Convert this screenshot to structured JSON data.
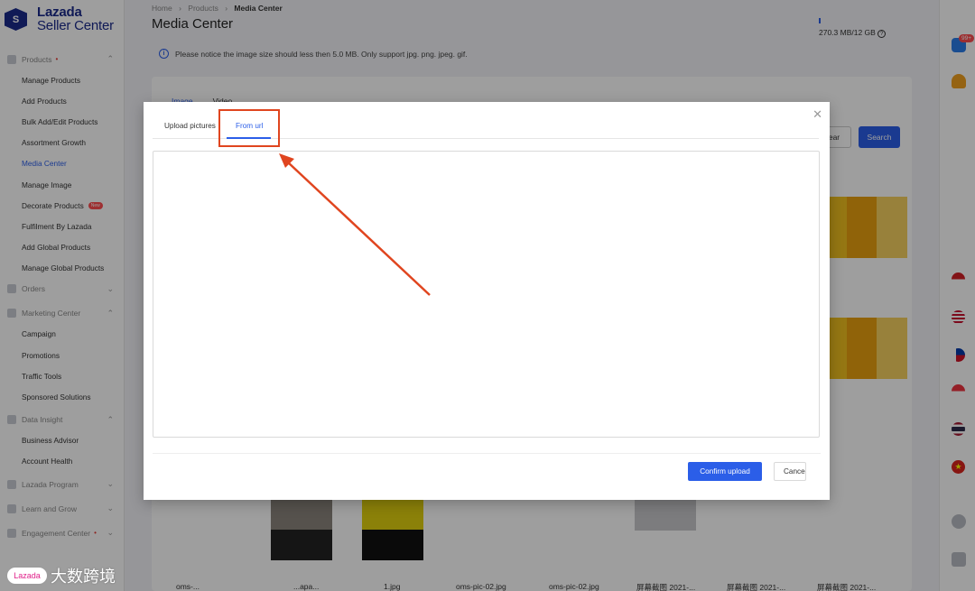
{
  "brand": {
    "line1": "Lazada",
    "line2": "Seller Center",
    "mark": "S"
  },
  "sidebar": {
    "groups": [
      {
        "label": "Products",
        "dot": "•",
        "items": [
          "Manage Products",
          "Add Products",
          "Bulk Add/Edit Products",
          "Assortment Growth",
          "Media Center",
          "Manage Image",
          "Decorate Products",
          "Fulfilment By Lazada",
          "Add Global Products",
          "Manage Global Products"
        ]
      },
      {
        "label": "Orders"
      },
      {
        "label": "Marketing Center",
        "items": [
          "Campaign",
          "Promotions",
          "Traffic Tools",
          "Sponsored Solutions"
        ]
      },
      {
        "label": "Data Insight",
        "items": [
          "Business Advisor",
          "Account Health"
        ]
      },
      {
        "label": "Lazada Program"
      },
      {
        "label": "Learn and Grow"
      },
      {
        "label": "Engagement Center",
        "dot": "•"
      }
    ],
    "new_badge": "New"
  },
  "watermark": {
    "logo": "Lazada",
    "text": "大数跨境"
  },
  "breadcrumb": {
    "home": "Home",
    "products": "Products",
    "current": "Media Center",
    "sep": "›"
  },
  "page_title": "Media Center",
  "storage": "270.3 MB/12 GB",
  "notice": "Please notice the image size should less then 5.0 MB. Only support jpg. png. jpeg. gif.",
  "tabs_behind": {
    "image": "Image",
    "video": "Video"
  },
  "search_btn": "Search",
  "clear_btn": "ear",
  "files": [
    "oms-...",
    "...apa...",
    "1.jpg",
    "oms-pic-02.jpg",
    "oms-pic-02.jpg",
    "屏幕截图 2021-...",
    "屏幕截图 2021-...",
    "屏幕截图 2021-..."
  ],
  "rail": {
    "chat_badge": "99+"
  },
  "modal": {
    "tab_upload": "Upload pictures",
    "tab_url": "From url",
    "url_value": "",
    "confirm": "Confirm upload",
    "cancel": "Cancel"
  },
  "colors": {
    "accent": "#2b5ee8",
    "annotation": "#e0451f"
  }
}
